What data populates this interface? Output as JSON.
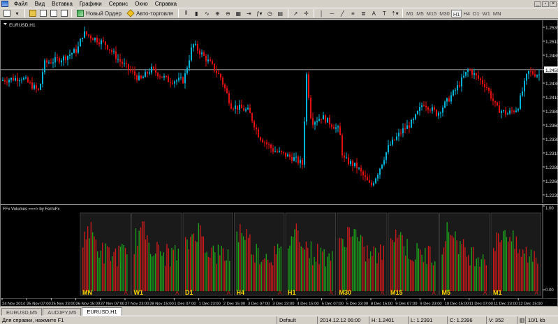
{
  "menu": [
    "Файл",
    "Вид",
    "Вставка",
    "Графики",
    "Сервис",
    "Окно",
    "Справка"
  ],
  "toolbar": {
    "new_order_label": "Новый Ордер",
    "auto_trading_label": "Авто-торговля",
    "timeframes": [
      "M1",
      "M5",
      "M15",
      "M30",
      "H1",
      "H4",
      "D1",
      "W1",
      "MN"
    ],
    "active_timeframe": "H1"
  },
  "chart": {
    "title": "EURUSD,H1",
    "current_price": "1.2459",
    "price_ticks": [
      "1.2535",
      "1.2510",
      "1.2485",
      "1.2459",
      "1.2435",
      "1.2410",
      "1.2385",
      "1.2360",
      "1.2335",
      "1.2310",
      "1.2285",
      "1.2260",
      "1.2235"
    ],
    "colors": {
      "bull": "#00b4d8",
      "bear": "#e01010",
      "grid": "#404040",
      "price_line": "#b0b0b0"
    }
  },
  "indicator": {
    "title": "FFx Volumes ===> by FerruFx",
    "scale_ticks": [
      "1.00",
      "0.00"
    ],
    "panels": [
      "MN",
      "W1",
      "D1",
      "H4",
      "H1",
      "M30",
      "M15",
      "M5",
      "M1"
    ],
    "panel_marker": "A",
    "colors": {
      "up": "#1aa31a",
      "down": "#cc1a1a",
      "label": "#ffd700"
    }
  },
  "time_axis": [
    "24 Nov 2014",
    "25 Nov 07:00",
    "25 Nov 23:00",
    "26 Nov 15:00",
    "27 Nov 07:00",
    "27 Nov 23:00",
    "28 Nov 15:00",
    "1 Dec 07:00",
    "1 Dec 23:00",
    "2 Dec 15:00",
    "3 Dec 07:00",
    "3 Dec 23:00",
    "4 Dec 15:00",
    "5 Dec 07:00",
    "5 Dec 23:00",
    "8 Dec 15:00",
    "9 Dec 07:00",
    "9 Dec 23:00",
    "10 Dec 15:00",
    "11 Dec 07:00",
    "11 Dec 23:00",
    "12 Dec 15:00"
  ],
  "tabs": [
    "EURUSD,M5",
    "AUDJPY,M5",
    "EURUSD,H1"
  ],
  "active_tab": "EURUSD,H1",
  "status": {
    "help": "Для справки, нажмите F1",
    "profile": "Default",
    "time": "2014.12.12 06:00",
    "high": "H: 1.2401",
    "low": "L: 1.2391",
    "close": "C: 1.2396",
    "volume": "V: 352",
    "traffic": "10/1 kb"
  }
}
